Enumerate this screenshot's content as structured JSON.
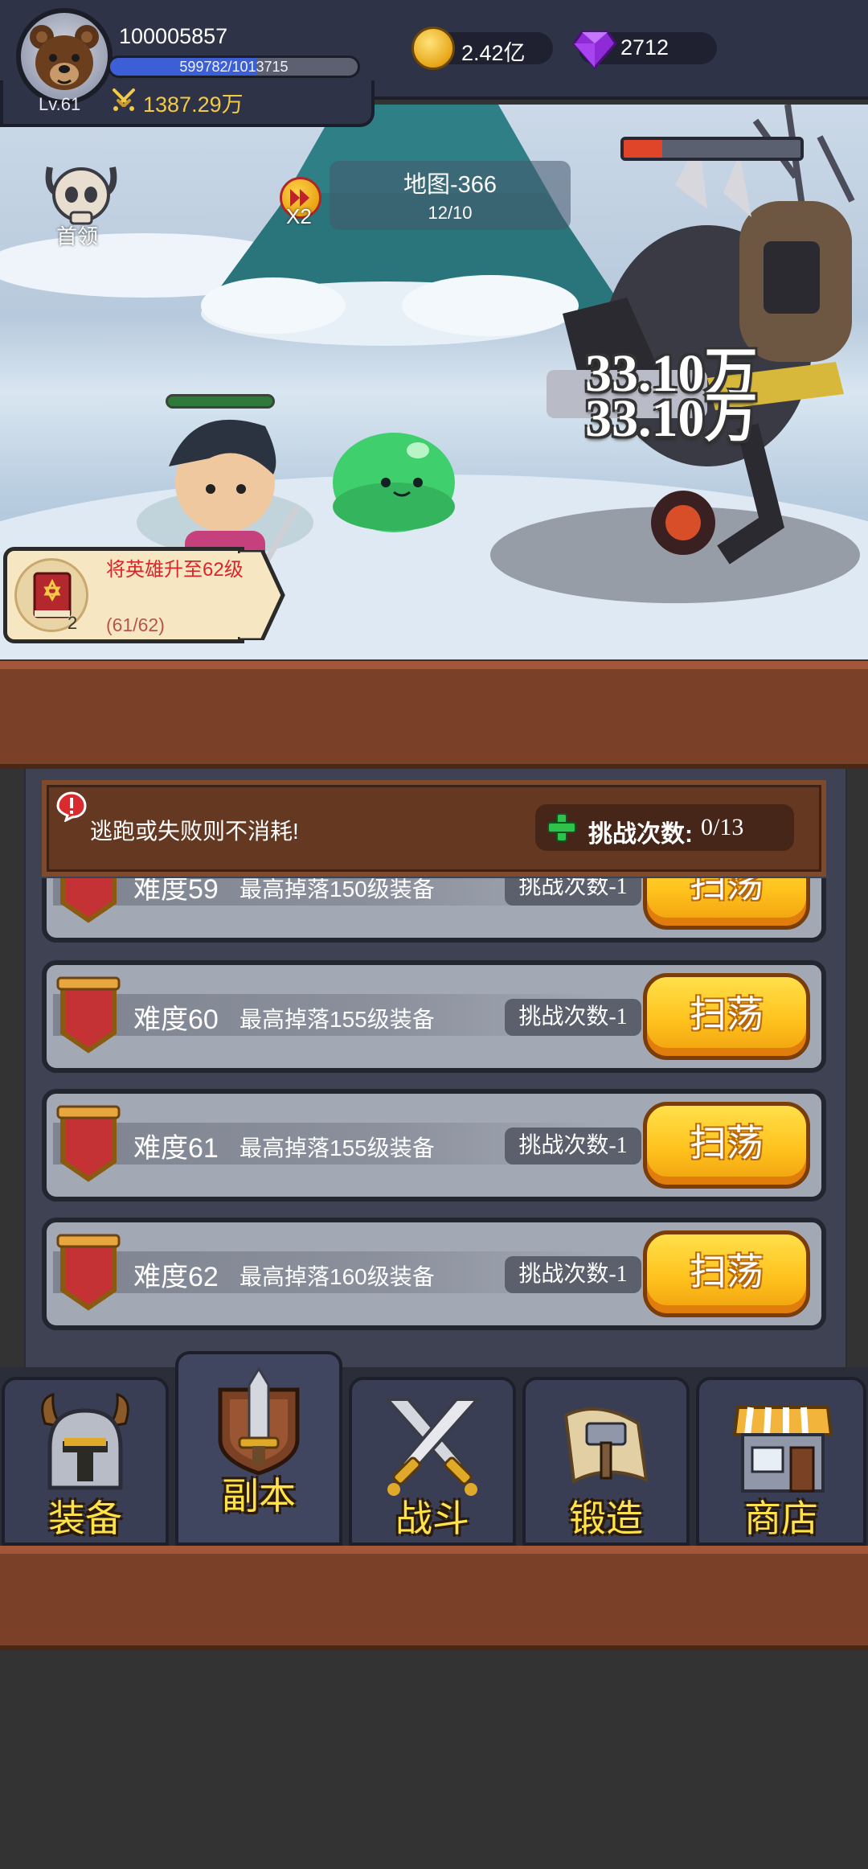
{
  "player": {
    "id": "100005857",
    "level": "Lv.61",
    "exp_text": "599782/1013715",
    "exp_ratio": 0.5917,
    "power": "1387.29万"
  },
  "currency": {
    "gold": "2.42亿",
    "gems": "2712"
  },
  "battle": {
    "boss_button_label": "首领",
    "speed_label": "X2",
    "map_name": "地图-366",
    "map_progress": "12/10",
    "boss_hp_ratio": 0.22,
    "damage_numbers": [
      "33.10万",
      "33.10万"
    ]
  },
  "quest": {
    "text": "将英雄升至62级",
    "progress": "(61/62)",
    "count": "2"
  },
  "dungeon": {
    "notice": "逃跑或失败则不消耗!",
    "challenge_label": "挑战次数:",
    "challenge_value": "0/13",
    "rows": [
      {
        "title": "难度59",
        "drop": "最高掉落150级装备",
        "cost": "挑战次数-1",
        "button": "扫荡"
      },
      {
        "title": "难度60",
        "drop": "最高掉落155级装备",
        "cost": "挑战次数-1",
        "button": "扫荡"
      },
      {
        "title": "难度61",
        "drop": "最高掉落155级装备",
        "cost": "挑战次数-1",
        "button": "扫荡"
      },
      {
        "title": "难度62",
        "drop": "最高掉落160级装备",
        "cost": "挑战次数-1",
        "button": "扫荡"
      }
    ]
  },
  "nav": {
    "tabs": [
      {
        "label": "装备",
        "icon": "helmet-icon"
      },
      {
        "label": "副本",
        "icon": "sword-shield-icon"
      },
      {
        "label": "战斗",
        "icon": "crossed-swords-icon"
      },
      {
        "label": "锻造",
        "icon": "hammer-scroll-icon"
      },
      {
        "label": "商店",
        "icon": "shop-icon"
      }
    ],
    "active_index": 1
  },
  "colors": {
    "accent_gold": "#ffc21d",
    "nav_label": "#ffe14a",
    "quest_red": "#d8262b",
    "wood": "#7a4128"
  }
}
